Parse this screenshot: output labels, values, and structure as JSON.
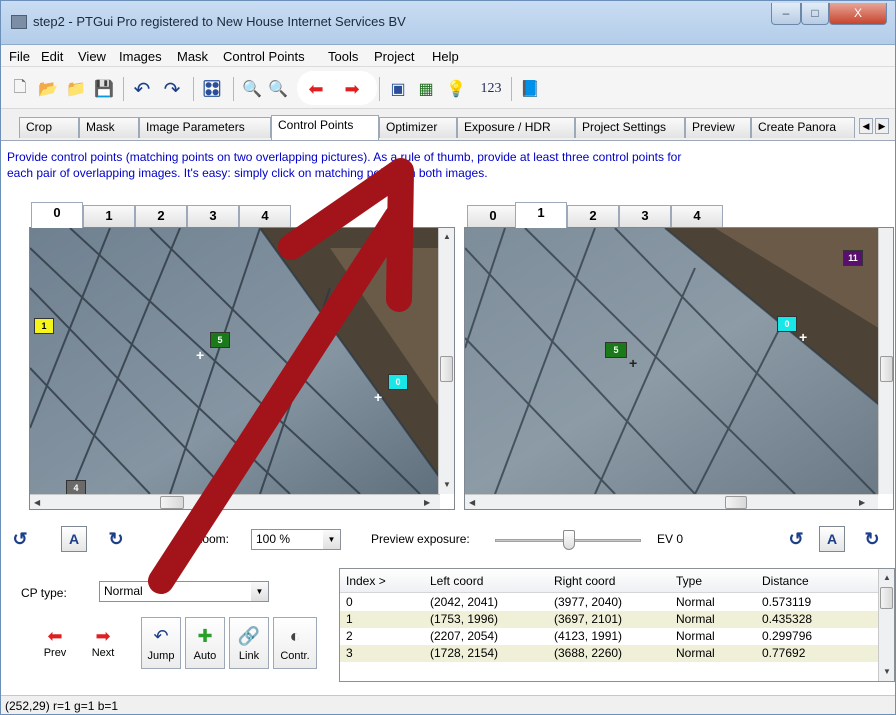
{
  "window": {
    "title": "step2 - PTGui Pro registered to New House Internet Services BV",
    "min_glyph": "–",
    "max_glyph": "□",
    "close_glyph": "X"
  },
  "menu": [
    "File",
    "Edit",
    "View",
    "Images",
    "Mask",
    "Control Points",
    "Tools",
    "Project",
    "Help"
  ],
  "toolbar": {
    "numbers_label": "123",
    "icons": [
      "new-project-icon",
      "open-project-icon",
      "open-images-icon",
      "save-icon",
      "undo-icon",
      "redo-icon",
      "settings-icon",
      "zoom-in-icon",
      "zoom-out-icon",
      "prev-icon",
      "next-icon",
      "batch-icon",
      "table-icon",
      "tip-icon",
      "numbers-icon",
      "help-book-icon"
    ]
  },
  "tabs": [
    "Crop",
    "Mask",
    "Image Parameters",
    "Control Points",
    "Optimizer",
    "Exposure / HDR",
    "Project Settings",
    "Preview",
    "Create Panora"
  ],
  "active_tab": "Control Points",
  "instructions": {
    "line1": "Provide control points (matching points on two overlapping pictures). As a rule of thumb, provide at least three control points for",
    "line2": "each pair of overlapping images. It's easy: simply click on matching points on both images."
  },
  "left_image": {
    "tabs": [
      "0",
      "1",
      "2",
      "3",
      "4"
    ],
    "active": "0",
    "points": [
      "1",
      "5",
      "0",
      "4"
    ]
  },
  "right_image": {
    "tabs": [
      "0",
      "1",
      "2",
      "3",
      "4"
    ],
    "active": "1",
    "points": [
      "11",
      "0",
      "5"
    ]
  },
  "controls": {
    "auto_label": "A",
    "zoom_label": "Zoom:",
    "zoom_value": "100 %",
    "exposure_label": "Preview exposure:",
    "ev_label": "EV 0"
  },
  "cp_panel": {
    "type_label": "CP type:",
    "type_value": "Normal",
    "buttons": [
      "Prev",
      "Next",
      "Jump",
      "Auto",
      "Link",
      "Contr."
    ]
  },
  "table": {
    "headers": [
      "Index >",
      "Left coord",
      "Right coord",
      "Type",
      "Distance"
    ],
    "rows": [
      {
        "index": "0",
        "left": "(2042, 2041)",
        "right": "(3977, 2040)",
        "type": "Normal",
        "distance": "0.573119"
      },
      {
        "index": "1",
        "left": "(1753, 1996)",
        "right": "(3697, 2101)",
        "type": "Normal",
        "distance": "0.435328"
      },
      {
        "index": "2",
        "left": "(2207, 2054)",
        "right": "(4123, 1991)",
        "type": "Normal",
        "distance": "0.299796"
      },
      {
        "index": "3",
        "left": "(1728, 2154)",
        "right": "(3688, 2260)",
        "type": "Normal",
        "distance": "0.77692"
      }
    ]
  },
  "status": "(252,29)  r=1  g=1  b=1",
  "colors": {
    "instruction_text": "#0000c8",
    "cp_yellow": "#f5f51a",
    "cp_green": "#1a7a1a",
    "cp_cyan": "#19e6e6",
    "cp_purple": "#5a0f6e",
    "overlay_arrow": "#a3131a"
  }
}
